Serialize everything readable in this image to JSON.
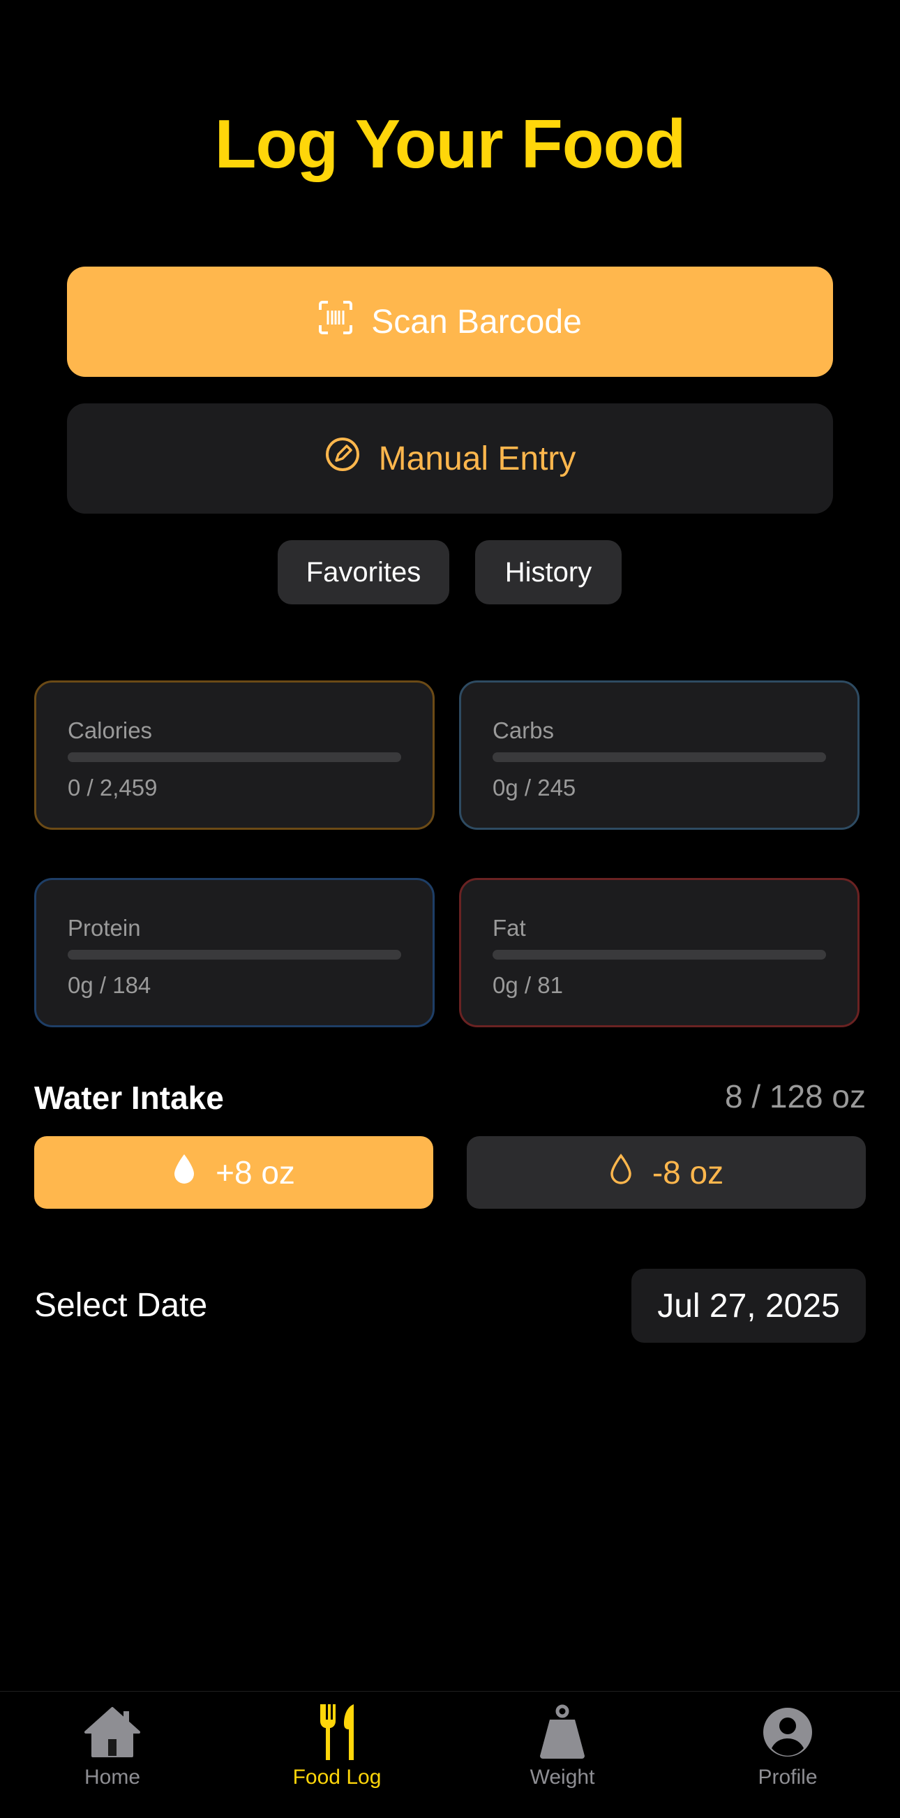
{
  "header": {
    "title": "Log Your Food"
  },
  "actions": {
    "scan_label": "Scan Barcode",
    "manual_label": "Manual Entry",
    "favorites_label": "Favorites",
    "history_label": "History"
  },
  "macros": [
    {
      "label": "Calories",
      "value": "0 / 2,459",
      "progress": 0,
      "color": "#FFB74D"
    },
    {
      "label": "Carbs",
      "value": "0g / 245",
      "progress": 0,
      "color": "#4FA3D9"
    },
    {
      "label": "Protein",
      "value": "0g / 184",
      "progress": 0,
      "color": "#3478F6"
    },
    {
      "label": "Fat",
      "value": "0g / 81",
      "progress": 0,
      "color": "#E0433B"
    }
  ],
  "water": {
    "title": "Water Intake",
    "count": "8 / 128 oz",
    "add_label": "+8 oz",
    "remove_label": "-8 oz"
  },
  "date": {
    "label": "Select Date",
    "value": "Jul 27, 2025"
  },
  "tabs": [
    {
      "label": "Home",
      "icon": "house-icon",
      "active": false
    },
    {
      "label": "Food Log",
      "icon": "fork-knife-icon",
      "active": true
    },
    {
      "label": "Weight",
      "icon": "scale-icon",
      "active": false
    },
    {
      "label": "Profile",
      "icon": "person-circle-icon",
      "active": false
    }
  ],
  "colors": {
    "accent": "#FFB74D",
    "title": "#FFD60A",
    "background": "#000000"
  }
}
